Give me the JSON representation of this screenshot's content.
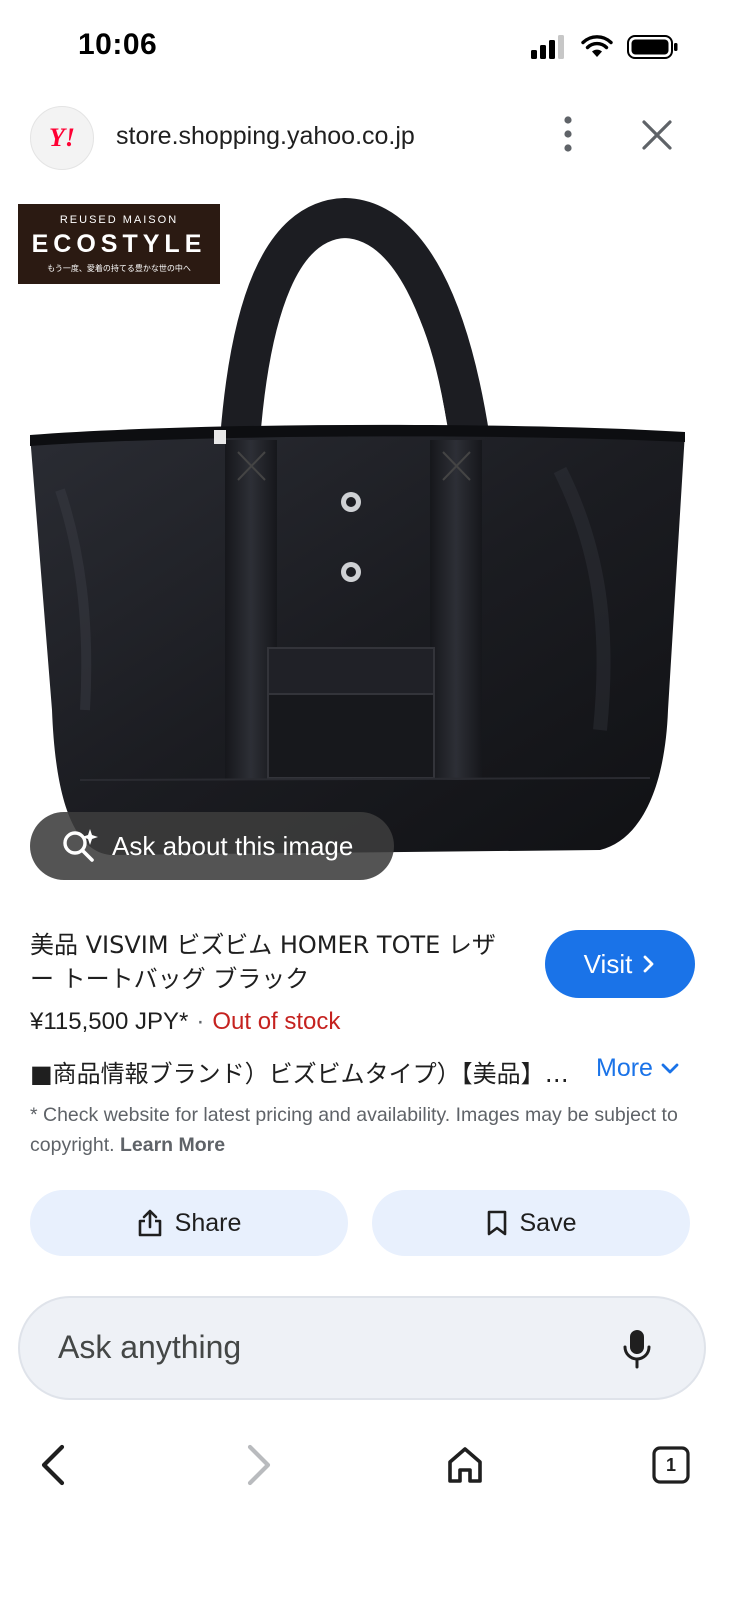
{
  "status": {
    "time": "10:06"
  },
  "browser": {
    "url": "store.shopping.yahoo.co.jp",
    "site_logo_text": "Y!"
  },
  "image": {
    "shop_badge": {
      "top": "REUSED MAISON",
      "main": "ECOSTYLE",
      "sub": "もう一度、愛着の持てる豊かな世の中へ"
    },
    "ask_image_label": "Ask about this image"
  },
  "product": {
    "title": "美品 VISVIM ビズビム HOMER TOTE レザー トートバッグ ブラック",
    "price": "¥115,500 JPY*",
    "separator": "·",
    "stock": "Out of stock",
    "description": "■商品情報ブランド）ビズビムタイプ）【美品】トートバッグ",
    "more_label": "More",
    "visit_label": "Visit",
    "disclaimer": "* Check website for latest pricing and availability. Images may be subject to copyright.",
    "learn_more": "Learn More"
  },
  "actions": {
    "share_label": "Share",
    "save_label": "Save"
  },
  "ask_bar": {
    "placeholder": "Ask anything"
  },
  "nav": {
    "tab_count": "1"
  },
  "colors": {
    "accent": "#1a73e8",
    "out_of_stock": "#c5221f",
    "chip_bg": "#e8f0fd",
    "ask_bar_bg": "#eef1f6"
  }
}
